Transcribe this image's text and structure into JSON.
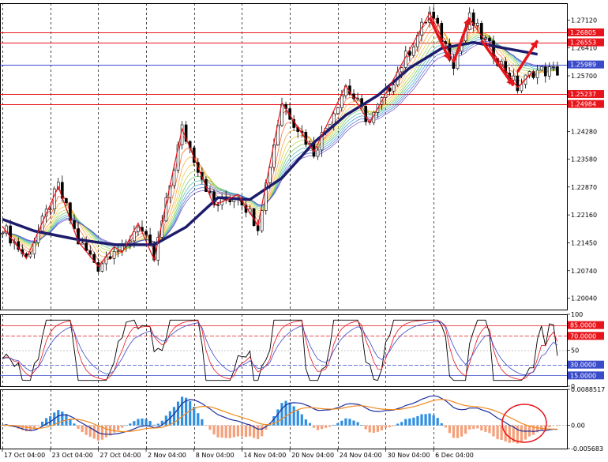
{
  "chart_data": {
    "type": "line",
    "main": {
      "y_ticks": [
        "1.27120",
        "1.26410",
        "1.25700",
        "1.24990",
        "1.24280",
        "1.23580",
        "1.22870",
        "1.22160",
        "1.21450",
        "1.20740",
        "1.20040"
      ],
      "ylim": [
        1.1975,
        1.2755
      ],
      "levels": [
        {
          "value": 1.26805,
          "label": "1.26805",
          "color": "#e8141b"
        },
        {
          "value": 1.26553,
          "label": "1.26553",
          "color": "#e8141b"
        },
        {
          "value": 1.25989,
          "label": "1.25989",
          "color": "#3a4bc9"
        },
        {
          "value": 1.25237,
          "label": "1.25237",
          "color": "#e8141b"
        },
        {
          "value": 1.24984,
          "label": "1.24984",
          "color": "#e8141b"
        }
      ],
      "zigzag": [
        [
          0,
          1.2187
        ],
        [
          6,
          1.2105
        ],
        [
          14,
          1.2288
        ],
        [
          19,
          1.2148
        ],
        [
          24,
          1.2085
        ],
        [
          28,
          1.2135
        ],
        [
          30,
          1.212
        ],
        [
          34,
          1.2195
        ],
        [
          38,
          1.2102
        ],
        [
          45,
          1.2435
        ],
        [
          53,
          1.224
        ],
        [
          59,
          1.2268
        ],
        [
          64,
          1.219
        ],
        [
          70,
          1.2502
        ],
        [
          78,
          1.2376
        ],
        [
          86,
          1.2545
        ],
        [
          92,
          1.245
        ],
        [
          107,
          1.273
        ],
        [
          113,
          1.2605
        ],
        [
          117,
          1.2716
        ],
        [
          129,
          1.254
        ],
        [
          133,
          1.2582
        ]
      ],
      "arrows": [
        [
          [
            107,
            1.2718
          ],
          [
            112,
            1.261
          ]
        ],
        [
          [
            113,
            1.2605
          ],
          [
            117,
            1.2718
          ]
        ],
        [
          [
            120,
            1.266
          ],
          [
            128,
            1.2545
          ]
        ],
        [
          [
            129,
            1.258
          ],
          [
            134,
            1.266
          ]
        ]
      ],
      "ma_thick": [
        [
          0,
          1.2205
        ],
        [
          8,
          1.2175
        ],
        [
          18,
          1.2155
        ],
        [
          28,
          1.214
        ],
        [
          38,
          1.214
        ],
        [
          46,
          1.2185
        ],
        [
          54,
          1.226
        ],
        [
          62,
          1.2255
        ],
        [
          70,
          1.231
        ],
        [
          78,
          1.24
        ],
        [
          86,
          1.247
        ],
        [
          94,
          1.252
        ],
        [
          102,
          1.259
        ],
        [
          110,
          1.264
        ],
        [
          118,
          1.2655
        ],
        [
          126,
          1.264
        ],
        [
          134,
          1.2625
        ]
      ]
    },
    "rsi": {
      "y_ticks": [
        "100",
        "50",
        "0"
      ],
      "ylim": [
        0,
        100
      ],
      "levels": [
        {
          "value": 85,
          "label": "85.0000",
          "color": "#e8141b"
        },
        {
          "value": 70,
          "label": "70.0000",
          "color": "#e8141b"
        },
        {
          "value": 30,
          "label": "30.0000",
          "color": "#3a4bc9"
        },
        {
          "value": 15,
          "label": "15.0000",
          "color": "#3a4bc9"
        }
      ]
    },
    "macd": {
      "y_ticks": [
        "0.0088517",
        "0.00",
        "-0.005683"
      ],
      "ylim": [
        -0.005683,
        0.0088517
      ]
    },
    "x_ticks": [
      {
        "i": 0,
        "label": "17 Oct 04:00"
      },
      {
        "i": 12,
        "label": "23 Oct 04:00"
      },
      {
        "i": 24,
        "label": "27 Oct 04:00"
      },
      {
        "i": 36,
        "label": "2 Nov 04:00"
      },
      {
        "i": 48,
        "label": "8 Nov 04:00"
      },
      {
        "i": 60,
        "label": "14 Nov 04:00"
      },
      {
        "i": 72,
        "label": "20 Nov 04:00"
      },
      {
        "i": 84,
        "label": "24 Nov 04:00"
      },
      {
        "i": 96,
        "label": "30 Nov 04:00"
      },
      {
        "i": 108,
        "label": "6 Dec 04:00"
      }
    ]
  }
}
